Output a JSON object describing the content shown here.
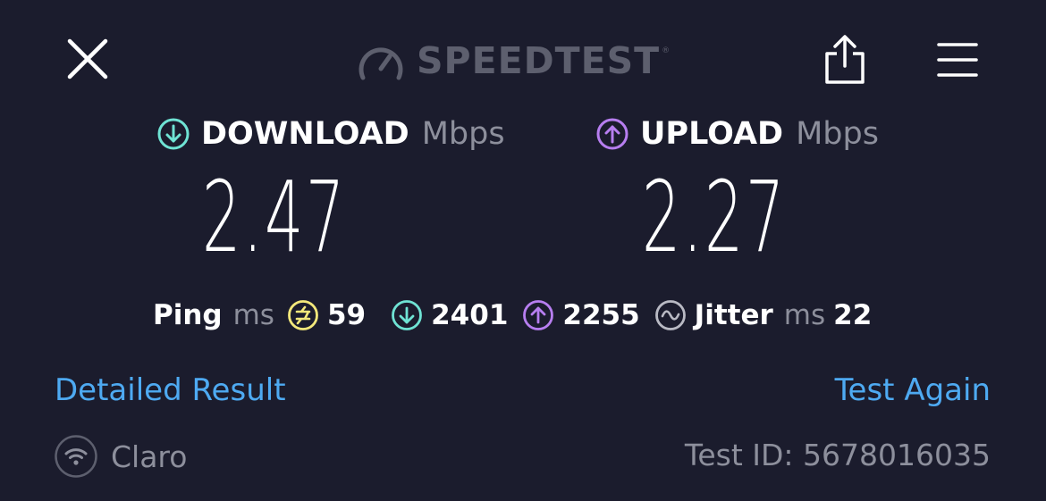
{
  "header": {
    "logo_text": "SPEEDTEST",
    "logo_tm": "®",
    "icons": [
      "close-icon",
      "speedometer-icon",
      "share-icon",
      "hamburger-menu-icon"
    ]
  },
  "download": {
    "label": "DOWNLOAD",
    "unit": "Mbps",
    "value": "2.47",
    "icon": "download-arrow-icon",
    "color": "#6fe3d4"
  },
  "upload": {
    "label": "UPLOAD",
    "unit": "Mbps",
    "value": "2.27",
    "icon": "upload-arrow-icon",
    "color": "#b77ef0"
  },
  "ping": {
    "label": "Ping",
    "unit": "ms",
    "idle": "59",
    "idle_icon": "ping-idle-icon",
    "idle_color": "#f3e87b",
    "download": "2401",
    "upload": "2255",
    "jitter_label": "Jitter",
    "jitter_unit": "ms",
    "jitter": "22",
    "jitter_icon": "jitter-wave-icon"
  },
  "links": {
    "detailed": "Detailed Result",
    "again": "Test Again"
  },
  "footer": {
    "provider": "Claro",
    "provider_icon": "wifi-icon",
    "test_id": "Test ID: 5678016035"
  },
  "colors": {
    "background": "#1b1c2d",
    "link": "#4eaaf2",
    "muted": "#8d8f9c"
  }
}
